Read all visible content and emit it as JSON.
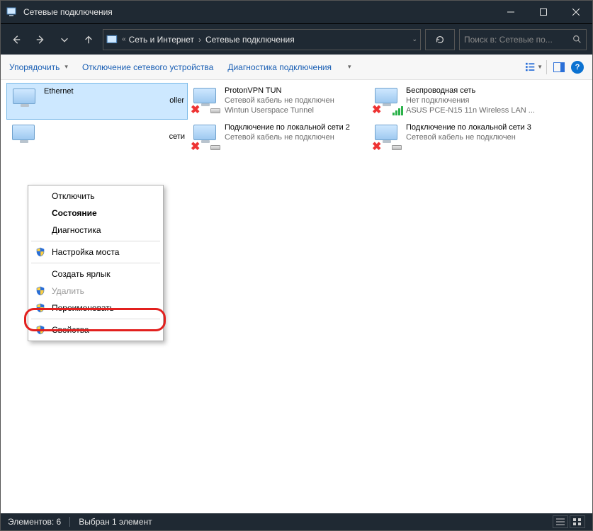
{
  "window": {
    "title": "Сетевые подключения"
  },
  "breadcrumb": {
    "seg1": "Сеть и Интернет",
    "seg2": "Сетевые подключения"
  },
  "search": {
    "placeholder": "Поиск в: Сетевые по..."
  },
  "toolbar": {
    "organize": "Упорядочить",
    "disable": "Отключение сетевого устройства",
    "diagnose": "Диагностика подключения"
  },
  "connections": [
    {
      "name": "Ethernet",
      "status": "",
      "device": "",
      "partialRight": "oller",
      "selected": true,
      "overlay": "none"
    },
    {
      "name": "ProtonVPN TUN",
      "status": "Сетевой кабель не подключен",
      "device": "Wintun Userspace Tunnel",
      "overlay": "cable"
    },
    {
      "name": "Беспроводная сеть",
      "status": "Нет подключения",
      "device": "ASUS PCE-N15 11n Wireless LAN ...",
      "overlay": "wifi"
    },
    {
      "name": "",
      "status": "",
      "device": "",
      "partialRight": "сети",
      "overlay": "none"
    },
    {
      "name": "Подключение по локальной сети 2",
      "status": "Сетевой кабель не подключен",
      "device": "",
      "overlay": "cable"
    },
    {
      "name": "Подключение по локальной сети 3",
      "status": "Сетевой кабель не подключен",
      "device": "",
      "overlay": "cable"
    }
  ],
  "contextMenu": {
    "disable": "Отключить",
    "status": "Состояние",
    "diagnose": "Диагностика",
    "bridge": "Настройка моста",
    "shortcut": "Создать ярлык",
    "delete": "Удалить",
    "rename": "Переименовать",
    "properties": "Свойства"
  },
  "statusbar": {
    "elements": "Элементов: 6",
    "selected": "Выбран 1 элемент"
  }
}
